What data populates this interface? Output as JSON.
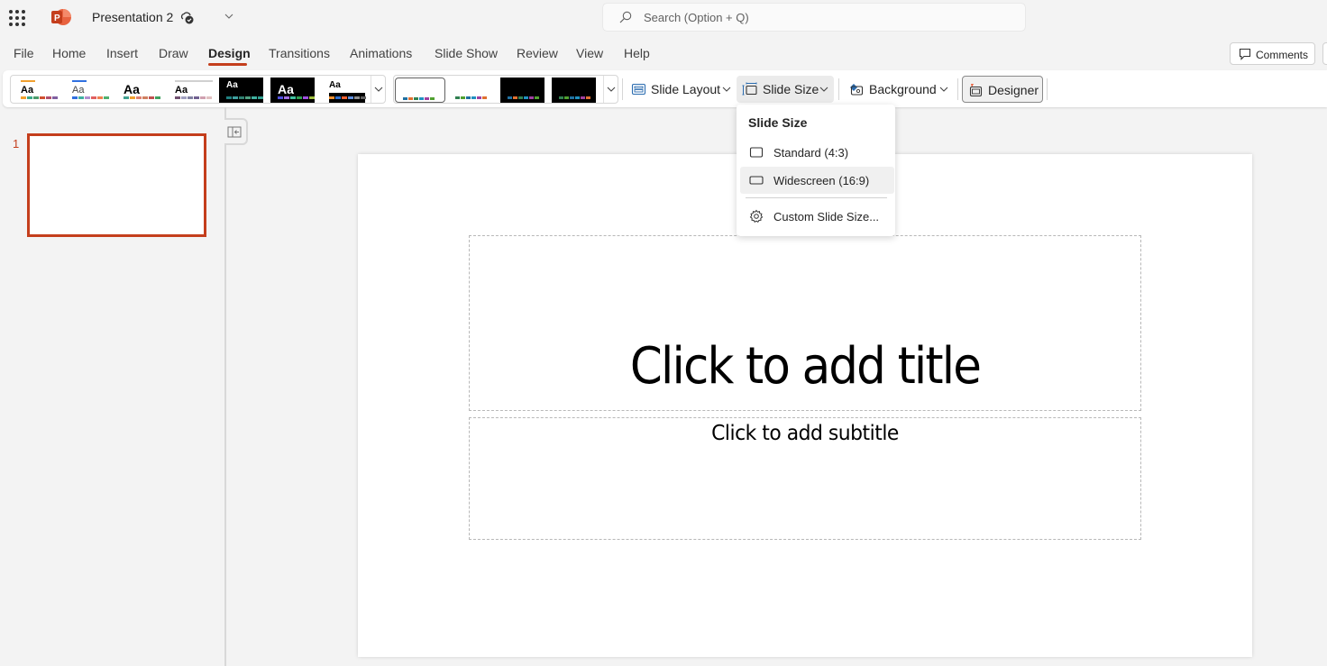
{
  "app": {
    "name": "PowerPoint",
    "document_title": "Presentation 2",
    "save_status_icon": "cloud-saved-icon",
    "brand_color": "#c43e1c"
  },
  "search": {
    "placeholder": "Search (Option + Q)"
  },
  "tabs": [
    {
      "label": "File",
      "active": false
    },
    {
      "label": "Home",
      "active": false
    },
    {
      "label": "Insert",
      "active": false
    },
    {
      "label": "Draw",
      "active": false
    },
    {
      "label": "Design",
      "active": true
    },
    {
      "label": "Transitions",
      "active": false
    },
    {
      "label": "Animations",
      "active": false
    },
    {
      "label": "Slide Show",
      "active": false
    },
    {
      "label": "Review",
      "active": false
    },
    {
      "label": "View",
      "active": false
    },
    {
      "label": "Help",
      "active": false
    }
  ],
  "header_actions": {
    "comments_label": "Comments"
  },
  "ribbon": {
    "themes": [
      {
        "sample": "Aa",
        "bg": "#ffffff",
        "fg": "#000000",
        "accent_bar": "#f0a030",
        "swatches": [
          "#f0a030",
          "#3aaa8a",
          "#4a9a6a",
          "#d05030",
          "#b05070",
          "#8060a0"
        ]
      },
      {
        "sample": "Aa",
        "bg": "#ffffff",
        "fg": "#444444",
        "accent_bar": "#3070e0",
        "swatches": [
          "#3070e0",
          "#40b0a0",
          "#b090d0",
          "#e06060",
          "#f08050",
          "#50b070"
        ]
      },
      {
        "sample": "Aa",
        "bg": "#ffffff",
        "fg": "#000000",
        "accent_bar": "",
        "swatches": [
          "#40a090",
          "#f0a030",
          "#e08070",
          "#d08060",
          "#c05050",
          "#40a060"
        ]
      },
      {
        "sample": "Aa",
        "bg": "#ffffff",
        "fg": "#000000",
        "accent_bar": "#d0d0d0",
        "swatches": [
          "#705070",
          "#a0a0c0",
          "#8080a0",
          "#706090",
          "#d0a0b0",
          "#e0c0c0"
        ]
      },
      {
        "sample": "Aa",
        "bg": "#000000",
        "fg": "#ffffff",
        "accent_bar": "",
        "swatches": [
          "#208080",
          "#40a0a0",
          "#308070",
          "#50a080",
          "#40b0a0",
          "#30a090"
        ]
      },
      {
        "sample": "Aa",
        "bg": "#000000",
        "fg": "#ffffff",
        "accent_bar": "",
        "swatches": [
          "#5050e0",
          "#a070e0",
          "#40c0a0",
          "#30a050",
          "#a050e0",
          "#a0c040"
        ]
      },
      {
        "sample": "Aa",
        "bg": "#ffffff",
        "fg": "#000000",
        "accent_bar": "",
        "swatches": [
          "#f09030",
          "#3070d0",
          "#f06030",
          "#6090e0",
          "#909090",
          "#606060"
        ]
      }
    ],
    "variants": [
      {
        "bg": "#ffffff",
        "selected": true,
        "swatches": [
          "#2070a0",
          "#e07030",
          "#308050",
          "#2090c0",
          "#a040a0",
          "#50a030"
        ]
      },
      {
        "bg": "#ffffff",
        "selected": false,
        "swatches": [
          "#308050",
          "#50a030",
          "#2070a0",
          "#2090c0",
          "#a040a0",
          "#e07030"
        ]
      },
      {
        "bg": "#000000",
        "selected": false,
        "swatches": [
          "#2070a0",
          "#e07030",
          "#308050",
          "#2090c0",
          "#a040a0",
          "#50a030"
        ]
      },
      {
        "bg": "#000000",
        "selected": false,
        "swatches": [
          "#308050",
          "#50a030",
          "#2070a0",
          "#2090c0",
          "#a040a0",
          "#e07030"
        ]
      }
    ],
    "buttons": {
      "slide_layout": "Slide Layout",
      "slide_size": "Slide Size",
      "background": "Background",
      "designer": "Designer"
    }
  },
  "slide_size_menu": {
    "header": "Slide Size",
    "items": [
      {
        "label": "Standard (4:3)",
        "icon": "rectangle-icon",
        "hovered": false
      },
      {
        "label": "Widescreen (16:9)",
        "icon": "rectangle-icon",
        "hovered": true
      },
      {
        "label": "Custom Slide Size...",
        "icon": "gear-icon",
        "hovered": false
      }
    ]
  },
  "thumbnails": [
    {
      "number": "1",
      "selected": true
    }
  ],
  "slide": {
    "title_placeholder": "Click to add title",
    "subtitle_placeholder": "Click to add subtitle"
  }
}
